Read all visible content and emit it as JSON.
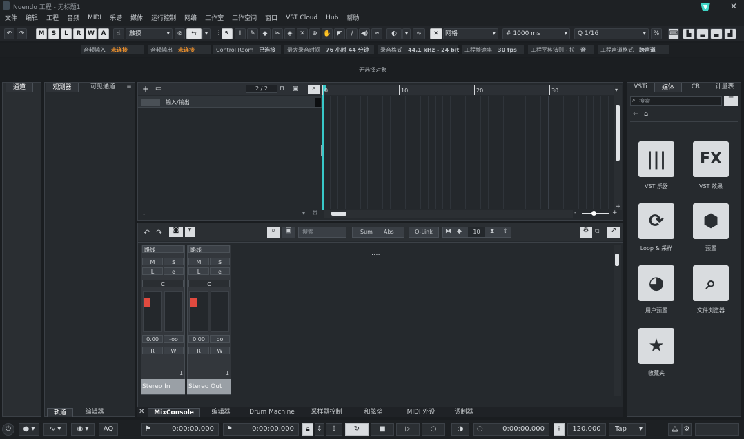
{
  "window": {
    "title": "Nuendo 工程 - 无标题1",
    "close": "✕"
  },
  "menus": [
    "文件",
    "编辑",
    "工程",
    "音频",
    "MIDI",
    "乐谱",
    "媒体",
    "运行控制",
    "网络",
    "工作室",
    "工作空间",
    "窗口",
    "VST Cloud",
    "Hub",
    "帮助"
  ],
  "toolbar": {
    "mode_buttons": [
      "M",
      "S",
      "L",
      "R",
      "W",
      "A"
    ],
    "touch_mode": "触摸",
    "grid_type": "网格",
    "grid_value": "1000 ms",
    "quantize": "1/16"
  },
  "info": [
    {
      "label": "音频输入",
      "value": "未连接",
      "warn": true
    },
    {
      "label": "音频输出",
      "value": "未连接",
      "warn": true
    },
    {
      "label": "Control Room",
      "value": "已连接",
      "warn": false
    },
    {
      "label": "最大录音时间",
      "value": "76 小时 44 分钟",
      "warn": false
    },
    {
      "label": "录音格式",
      "value": "44.1 kHz - 24 bit",
      "warn": false
    },
    {
      "label": "工程帧速率",
      "value": "30 fps",
      "warn": false
    },
    {
      "label": "工程平移法则 - 拉",
      "value": "音",
      "warn": false
    },
    {
      "label": "工程声道格式",
      "value": "跨声道",
      "warn": false
    }
  ],
  "event_line": {
    "no_selection": "无选择对象"
  },
  "left_zone": {
    "tab": "通道"
  },
  "inspector": {
    "tabs": [
      "观测器",
      "可见通道"
    ],
    "bottom_tabs": [
      "轨道",
      "编辑器"
    ]
  },
  "project": {
    "track_count": "2 / 2",
    "track_name": "输入/输出",
    "ruler": [
      "0",
      "10",
      "20",
      "30"
    ]
  },
  "mixer": {
    "search_placeholder": "搜索",
    "sum": "Sum",
    "abs": "Abs",
    "qlink": "Q-Link",
    "columns": "10",
    "strips": [
      {
        "routing": "路线",
        "m": "M",
        "s": "S",
        "l": "L",
        "pan_value": "0.00",
        "pan_label": "C",
        "vol": "0.00",
        "vol2": "-oo",
        "r": "R",
        "w": "W",
        "name": "Stereo In",
        "channel": "1"
      },
      {
        "routing": "路线",
        "m": "M",
        "s": "S",
        "l": "L",
        "pan_value": "0.00",
        "pan_label": "C",
        "vol": "0.00",
        "vol2": "oo",
        "r": "R",
        "w": "W",
        "name": "Stereo Out",
        "channel": "1"
      }
    ],
    "bottom_tabs": [
      "MixConsole",
      "编辑器",
      "Drum Machine",
      "采样器控制",
      "和弦垫",
      "MIDI 外设",
      "调制器"
    ],
    "close": "✕"
  },
  "right": {
    "tabs": [
      "VSTi",
      "媒体",
      "CR",
      "计量表"
    ],
    "search_placeholder": "搜索",
    "tiles": [
      {
        "label": "VST 乐器",
        "icon": "piano-keys-icon"
      },
      {
        "label": "VST 效果",
        "icon": "fx-icon"
      },
      {
        "label": "Loop & 采样",
        "icon": "loop-icon"
      },
      {
        "label": "预置",
        "icon": "presets-icon"
      },
      {
        "label": "用户预置",
        "icon": "user-presets-icon"
      },
      {
        "label": "文件浏览器",
        "icon": "file-browser-icon"
      },
      {
        "label": "收藏夹",
        "icon": "star-icon"
      }
    ]
  },
  "transport": {
    "aq": "AQ",
    "left_locator": "0:00:00.000",
    "right_locator": "0:00:00.000",
    "position": "0:00:00.000",
    "tempo": "120.000",
    "tap": "Tap"
  }
}
